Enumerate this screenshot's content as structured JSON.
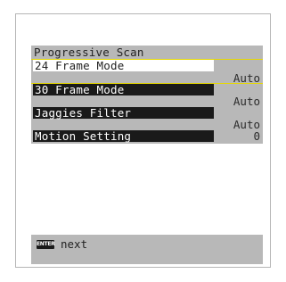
{
  "menu": {
    "title": "Progressive Scan",
    "rows": [
      {
        "label": "24 Frame Mode",
        "value": "Auto"
      },
      {
        "label": "30 Frame Mode",
        "value": "Auto"
      },
      {
        "label": "Jaggies Filter",
        "value": "Auto"
      },
      {
        "label": "Motion Setting",
        "value": "0"
      }
    ]
  },
  "hint": {
    "key_label": "ENTER",
    "text": "next"
  },
  "colors": {
    "menu_bg": "#b8b8b8",
    "row_label_bg": "#1a1a1a",
    "selected_border": "#e6d800"
  }
}
